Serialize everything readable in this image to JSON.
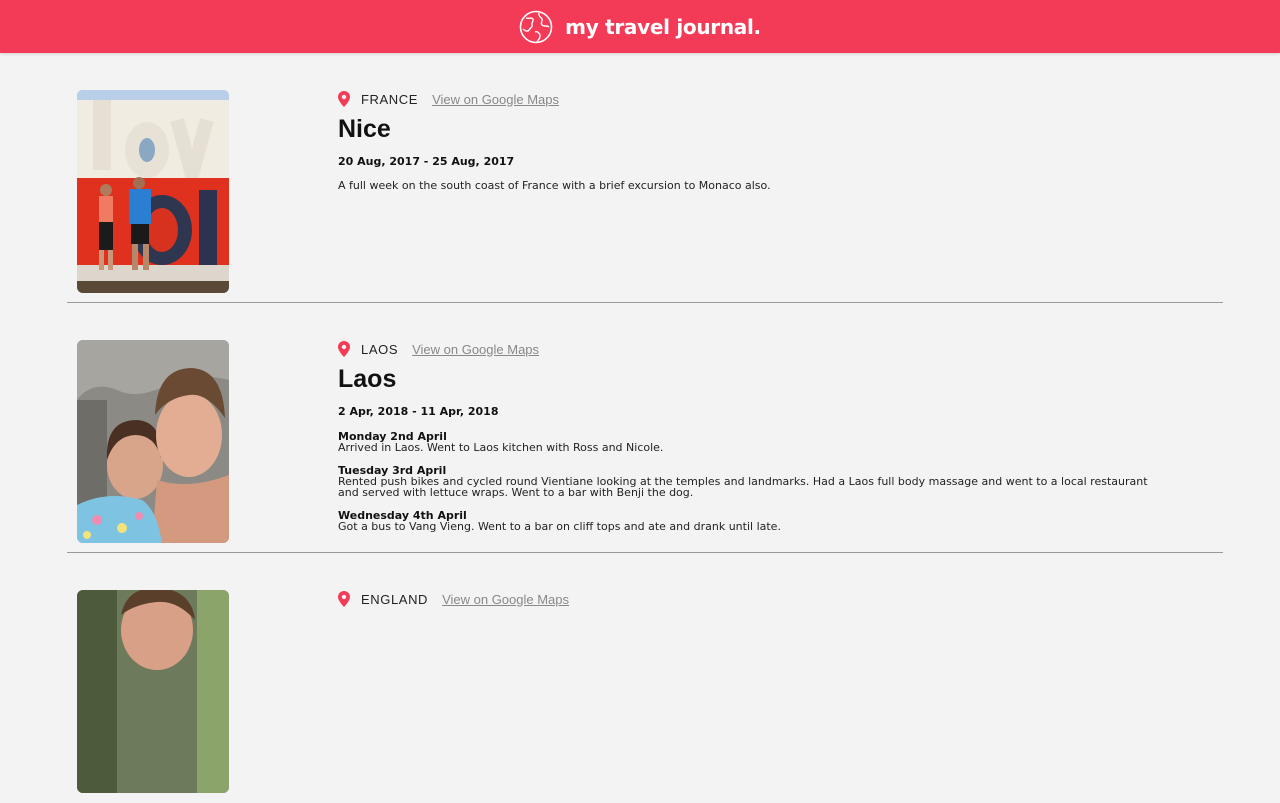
{
  "header": {
    "title": "my travel journal."
  },
  "colors": {
    "brand": "#f33a56",
    "background": "#f3f3f3",
    "link": "#888888"
  },
  "entries": [
    {
      "country": "FRANCE",
      "maps_link": "View on Google Maps",
      "place": "Nice",
      "dates": "20 Aug, 2017 - 25 Aug, 2017",
      "description": "A full week on the south coast of France with a brief excursion to Monaco also."
    },
    {
      "country": "LAOS",
      "maps_link": "View on Google Maps",
      "place": "Laos",
      "dates": "2 Apr, 2018 - 11 Apr, 2018",
      "days": [
        {
          "title": "Monday 2nd April",
          "text": "Arrived in Laos. Went to Laos kitchen with Ross and Nicole."
        },
        {
          "title": "Tuesday 3rd April",
          "text": "Rented push bikes and cycled round Vientiane looking at the temples and landmarks. Had a Laos full body massage and went to a local restaurant and served with lettuce wraps. Went to a bar with Benji the dog."
        },
        {
          "title": "Wednesday 4th April",
          "text": "Got a bus to Vang Vieng. Went to a bar on cliff tops and ate and drank until late."
        }
      ]
    },
    {
      "country": "ENGLAND",
      "maps_link": "View on Google Maps"
    }
  ]
}
